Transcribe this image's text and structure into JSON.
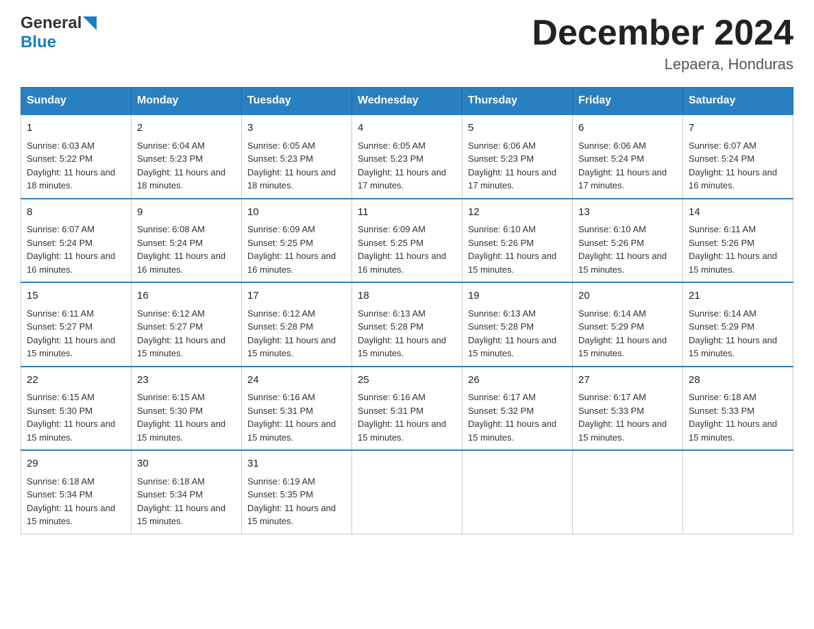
{
  "header": {
    "logo_line1": "General",
    "logo_line2": "Blue",
    "title": "December 2024",
    "subtitle": "Lepaera, Honduras"
  },
  "days_of_week": [
    "Sunday",
    "Monday",
    "Tuesday",
    "Wednesday",
    "Thursday",
    "Friday",
    "Saturday"
  ],
  "weeks": [
    [
      {
        "date": "1",
        "sunrise": "6:03 AM",
        "sunset": "5:22 PM",
        "daylight": "11 hours and 18 minutes."
      },
      {
        "date": "2",
        "sunrise": "6:04 AM",
        "sunset": "5:23 PM",
        "daylight": "11 hours and 18 minutes."
      },
      {
        "date": "3",
        "sunrise": "6:05 AM",
        "sunset": "5:23 PM",
        "daylight": "11 hours and 18 minutes."
      },
      {
        "date": "4",
        "sunrise": "6:05 AM",
        "sunset": "5:23 PM",
        "daylight": "11 hours and 17 minutes."
      },
      {
        "date": "5",
        "sunrise": "6:06 AM",
        "sunset": "5:23 PM",
        "daylight": "11 hours and 17 minutes."
      },
      {
        "date": "6",
        "sunrise": "6:06 AM",
        "sunset": "5:24 PM",
        "daylight": "11 hours and 17 minutes."
      },
      {
        "date": "7",
        "sunrise": "6:07 AM",
        "sunset": "5:24 PM",
        "daylight": "11 hours and 16 minutes."
      }
    ],
    [
      {
        "date": "8",
        "sunrise": "6:07 AM",
        "sunset": "5:24 PM",
        "daylight": "11 hours and 16 minutes."
      },
      {
        "date": "9",
        "sunrise": "6:08 AM",
        "sunset": "5:24 PM",
        "daylight": "11 hours and 16 minutes."
      },
      {
        "date": "10",
        "sunrise": "6:09 AM",
        "sunset": "5:25 PM",
        "daylight": "11 hours and 16 minutes."
      },
      {
        "date": "11",
        "sunrise": "6:09 AM",
        "sunset": "5:25 PM",
        "daylight": "11 hours and 16 minutes."
      },
      {
        "date": "12",
        "sunrise": "6:10 AM",
        "sunset": "5:26 PM",
        "daylight": "11 hours and 15 minutes."
      },
      {
        "date": "13",
        "sunrise": "6:10 AM",
        "sunset": "5:26 PM",
        "daylight": "11 hours and 15 minutes."
      },
      {
        "date": "14",
        "sunrise": "6:11 AM",
        "sunset": "5:26 PM",
        "daylight": "11 hours and 15 minutes."
      }
    ],
    [
      {
        "date": "15",
        "sunrise": "6:11 AM",
        "sunset": "5:27 PM",
        "daylight": "11 hours and 15 minutes."
      },
      {
        "date": "16",
        "sunrise": "6:12 AM",
        "sunset": "5:27 PM",
        "daylight": "11 hours and 15 minutes."
      },
      {
        "date": "17",
        "sunrise": "6:12 AM",
        "sunset": "5:28 PM",
        "daylight": "11 hours and 15 minutes."
      },
      {
        "date": "18",
        "sunrise": "6:13 AM",
        "sunset": "5:28 PM",
        "daylight": "11 hours and 15 minutes."
      },
      {
        "date": "19",
        "sunrise": "6:13 AM",
        "sunset": "5:28 PM",
        "daylight": "11 hours and 15 minutes."
      },
      {
        "date": "20",
        "sunrise": "6:14 AM",
        "sunset": "5:29 PM",
        "daylight": "11 hours and 15 minutes."
      },
      {
        "date": "21",
        "sunrise": "6:14 AM",
        "sunset": "5:29 PM",
        "daylight": "11 hours and 15 minutes."
      }
    ],
    [
      {
        "date": "22",
        "sunrise": "6:15 AM",
        "sunset": "5:30 PM",
        "daylight": "11 hours and 15 minutes."
      },
      {
        "date": "23",
        "sunrise": "6:15 AM",
        "sunset": "5:30 PM",
        "daylight": "11 hours and 15 minutes."
      },
      {
        "date": "24",
        "sunrise": "6:16 AM",
        "sunset": "5:31 PM",
        "daylight": "11 hours and 15 minutes."
      },
      {
        "date": "25",
        "sunrise": "6:16 AM",
        "sunset": "5:31 PM",
        "daylight": "11 hours and 15 minutes."
      },
      {
        "date": "26",
        "sunrise": "6:17 AM",
        "sunset": "5:32 PM",
        "daylight": "11 hours and 15 minutes."
      },
      {
        "date": "27",
        "sunrise": "6:17 AM",
        "sunset": "5:33 PM",
        "daylight": "11 hours and 15 minutes."
      },
      {
        "date": "28",
        "sunrise": "6:18 AM",
        "sunset": "5:33 PM",
        "daylight": "11 hours and 15 minutes."
      }
    ],
    [
      {
        "date": "29",
        "sunrise": "6:18 AM",
        "sunset": "5:34 PM",
        "daylight": "11 hours and 15 minutes."
      },
      {
        "date": "30",
        "sunrise": "6:18 AM",
        "sunset": "5:34 PM",
        "daylight": "11 hours and 15 minutes."
      },
      {
        "date": "31",
        "sunrise": "6:19 AM",
        "sunset": "5:35 PM",
        "daylight": "11 hours and 15 minutes."
      },
      null,
      null,
      null,
      null
    ]
  ],
  "labels": {
    "sunrise": "Sunrise:",
    "sunset": "Sunset:",
    "daylight": "Daylight:"
  }
}
